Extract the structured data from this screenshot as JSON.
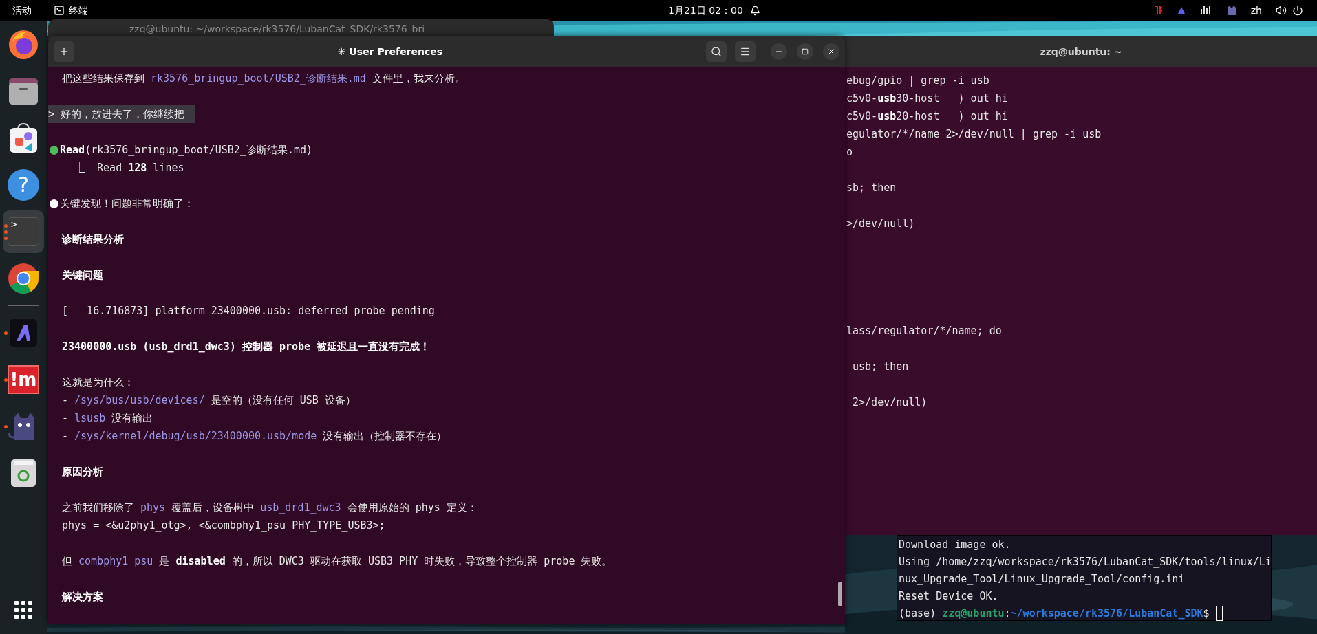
{
  "top_bar": {
    "activities": "活动",
    "app_name": "终端",
    "clock": "1月21日 02：00",
    "language": "zh"
  },
  "dock": {
    "items": [
      {
        "kind": "firefox",
        "selected": false,
        "running": false
      },
      {
        "kind": "files",
        "selected": false,
        "running": false
      },
      {
        "kind": "store",
        "selected": false,
        "running": false
      },
      {
        "kind": "help",
        "glyph": "?",
        "selected": false,
        "running": false
      },
      {
        "kind": "terminal",
        "glyph": ">_",
        "selected": true,
        "running": true,
        "multiple_windows": true
      },
      {
        "kind": "chrome",
        "selected": false,
        "running": false
      },
      {
        "kind": "divider"
      },
      {
        "kind": "a-app",
        "selected": false,
        "running": true
      },
      {
        "kind": "im-app",
        "glyph": "!m",
        "selected": false,
        "running": true
      },
      {
        "kind": "cat-app",
        "selected": false,
        "running": true
      },
      {
        "kind": "trash",
        "selected": false,
        "running": false
      }
    ]
  },
  "back_window": {
    "title": "zzq@ubuntu: ~/workspace/rk3576/LubanCat_SDK/rk3576_bri"
  },
  "main_window": {
    "title": "✳ User Preferences",
    "lines": [
      {
        "kind": "text",
        "segments": [
          {
            "kind": "plain",
            "text": "把这些结果保存到 "
          },
          {
            "kind": "code",
            "text": "rk3576_bringup_boot/USB2_诊断结果.md"
          },
          {
            "kind": "plain",
            "text": " 文件里，我来分析。"
          }
        ]
      },
      {
        "kind": "blank"
      },
      {
        "kind": "user",
        "segments": [
          {
            "kind": "plain",
            "text": "> 好的，放进去了，你继续把 "
          }
        ]
      },
      {
        "kind": "blank"
      },
      {
        "kind": "tool",
        "segments": [
          {
            "kind": "bold",
            "text": "Read"
          },
          {
            "kind": "plain",
            "text": "(rk3576_bringup_boot/USB2_诊断结果.md)"
          }
        ]
      },
      {
        "kind": "result",
        "segments": [
          {
            "kind": "plain",
            "text": "⎿  Read "
          },
          {
            "kind": "bold",
            "text": "128"
          },
          {
            "kind": "plain",
            "text": " lines"
          }
        ]
      },
      {
        "kind": "blank"
      },
      {
        "kind": "bullet",
        "segments": [
          {
            "kind": "plain",
            "text": "关键发现！问题非常明确了："
          }
        ]
      },
      {
        "kind": "blank"
      },
      {
        "kind": "text",
        "segments": [
          {
            "kind": "bold",
            "text": "诊断结果分析"
          }
        ]
      },
      {
        "kind": "blank"
      },
      {
        "kind": "text",
        "segments": [
          {
            "kind": "bold",
            "text": "关键问题"
          }
        ]
      },
      {
        "kind": "blank"
      },
      {
        "kind": "text",
        "segments": [
          {
            "kind": "plain",
            "text": "[   16.716873] platform 23400000.usb: deferred probe pending"
          }
        ]
      },
      {
        "kind": "blank"
      },
      {
        "kind": "text",
        "segments": [
          {
            "kind": "bold",
            "text": "23400000.usb (usb_drd1_dwc3) 控制器 probe 被延迟且一直没有完成！"
          }
        ]
      },
      {
        "kind": "blank"
      },
      {
        "kind": "text",
        "segments": [
          {
            "kind": "plain",
            "text": "这就是为什么："
          }
        ]
      },
      {
        "kind": "text",
        "segments": [
          {
            "kind": "plain",
            "text": "- "
          },
          {
            "kind": "code",
            "text": "/sys/bus/usb/devices/"
          },
          {
            "kind": "plain",
            "text": " 是空的（没有任何 USB 设备）"
          }
        ]
      },
      {
        "kind": "text",
        "segments": [
          {
            "kind": "plain",
            "text": "- "
          },
          {
            "kind": "code",
            "text": "lsusb"
          },
          {
            "kind": "plain",
            "text": " 没有输出"
          }
        ]
      },
      {
        "kind": "text",
        "segments": [
          {
            "kind": "plain",
            "text": "- "
          },
          {
            "kind": "code",
            "text": "/sys/kernel/debug/usb/23400000.usb/mode"
          },
          {
            "kind": "plain",
            "text": " 没有输出（控制器不存在）"
          }
        ]
      },
      {
        "kind": "blank"
      },
      {
        "kind": "text",
        "segments": [
          {
            "kind": "bold",
            "text": "原因分析"
          }
        ]
      },
      {
        "kind": "blank"
      },
      {
        "kind": "text",
        "segments": [
          {
            "kind": "plain",
            "text": "之前我们移除了 "
          },
          {
            "kind": "code",
            "text": "phys"
          },
          {
            "kind": "plain",
            "text": " 覆盖后，设备树中 "
          },
          {
            "kind": "code",
            "text": "usb_drd1_dwc3"
          },
          {
            "kind": "plain",
            "text": " 会使用原始的 phys 定义："
          }
        ]
      },
      {
        "kind": "text",
        "segments": [
          {
            "kind": "plain",
            "text": "phys = <&u2phy1_otg>, <&combphy1_psu PHY_TYPE_USB3>;"
          }
        ]
      },
      {
        "kind": "blank"
      },
      {
        "kind": "text",
        "segments": [
          {
            "kind": "plain",
            "text": "但 "
          },
          {
            "kind": "code",
            "text": "combphy1_psu"
          },
          {
            "kind": "plain",
            "text": " 是 "
          },
          {
            "kind": "bold",
            "text": "disabled"
          },
          {
            "kind": "plain",
            "text": " 的，所以 DWC3 驱动在获取 USB3 PHY 时失败，导致整个控制器 probe 失败。"
          }
        ]
      },
      {
        "kind": "blank"
      },
      {
        "kind": "text",
        "segments": [
          {
            "kind": "bold",
            "text": "解决方案"
          }
        ]
      }
    ]
  },
  "right_window": {
    "title": "zzq@ubuntu: ~",
    "lines": [
      {
        "kind": "text",
        "segments": [
          {
            "kind": "plain",
            "text": "ebug/gpio | grep -i usb"
          }
        ]
      },
      {
        "kind": "text",
        "segments": [
          {
            "kind": "plain",
            "text": "c5v0-"
          },
          {
            "kind": "bold",
            "text": "usb"
          },
          {
            "kind": "plain",
            "text": "30-host   ) out hi"
          }
        ]
      },
      {
        "kind": "text",
        "segments": [
          {
            "kind": "plain",
            "text": "c5v0-"
          },
          {
            "kind": "bold",
            "text": "usb"
          },
          {
            "kind": "plain",
            "text": "20-host   ) out hi"
          }
        ]
      },
      {
        "kind": "text",
        "segments": [
          {
            "kind": "plain",
            "text": "egulator/*/name 2>/dev/null | grep -i usb"
          }
        ]
      },
      {
        "kind": "text",
        "segments": [
          {
            "kind": "plain",
            "text": "o"
          }
        ]
      },
      {
        "kind": "blank"
      },
      {
        "kind": "text",
        "segments": [
          {
            "kind": "plain",
            "text": "sb; then"
          }
        ]
      },
      {
        "kind": "blank"
      },
      {
        "kind": "text",
        "segments": [
          {
            "kind": "plain",
            "text": ">/dev/null)"
          }
        ]
      },
      {
        "kind": "blank"
      },
      {
        "kind": "blank"
      },
      {
        "kind": "blank"
      },
      {
        "kind": "blank"
      },
      {
        "kind": "blank"
      },
      {
        "kind": "text",
        "segments": [
          {
            "kind": "plain",
            "text": "lass/regulator/*/name; do"
          }
        ]
      },
      {
        "kind": "blank"
      },
      {
        "kind": "text",
        "segments": [
          {
            "kind": "plain",
            "text": " usb; then"
          }
        ]
      },
      {
        "kind": "blank"
      },
      {
        "kind": "text",
        "segments": [
          {
            "kind": "plain",
            "text": " 2>/dev/null)"
          }
        ]
      }
    ]
  },
  "small_window": {
    "lines": [
      {
        "kind": "text",
        "segments": [
          {
            "kind": "plain",
            "text": "Download image ok."
          }
        ]
      },
      {
        "kind": "text",
        "segments": [
          {
            "kind": "plain",
            "text": "Using /home/zzq/workspace/rk3576/LubanCat_SDK/tools/linux/Li"
          }
        ]
      },
      {
        "kind": "text",
        "segments": [
          {
            "kind": "plain",
            "text": "nux_Upgrade_Tool/Linux_Upgrade_Tool/config.ini"
          }
        ]
      },
      {
        "kind": "text",
        "segments": [
          {
            "kind": "plain",
            "text": "Reset Device OK."
          }
        ]
      },
      {
        "kind": "prompt",
        "segments": [
          {
            "kind": "plain",
            "text": "(base) "
          },
          {
            "kind": "user",
            "text": "zzq@ubuntu"
          },
          {
            "kind": "plain",
            "text": ":"
          },
          {
            "kind": "dir",
            "text": "~/workspace/rk3576/LubanCat_SDK"
          },
          {
            "kind": "plain",
            "text": "$ "
          }
        ]
      }
    ]
  }
}
